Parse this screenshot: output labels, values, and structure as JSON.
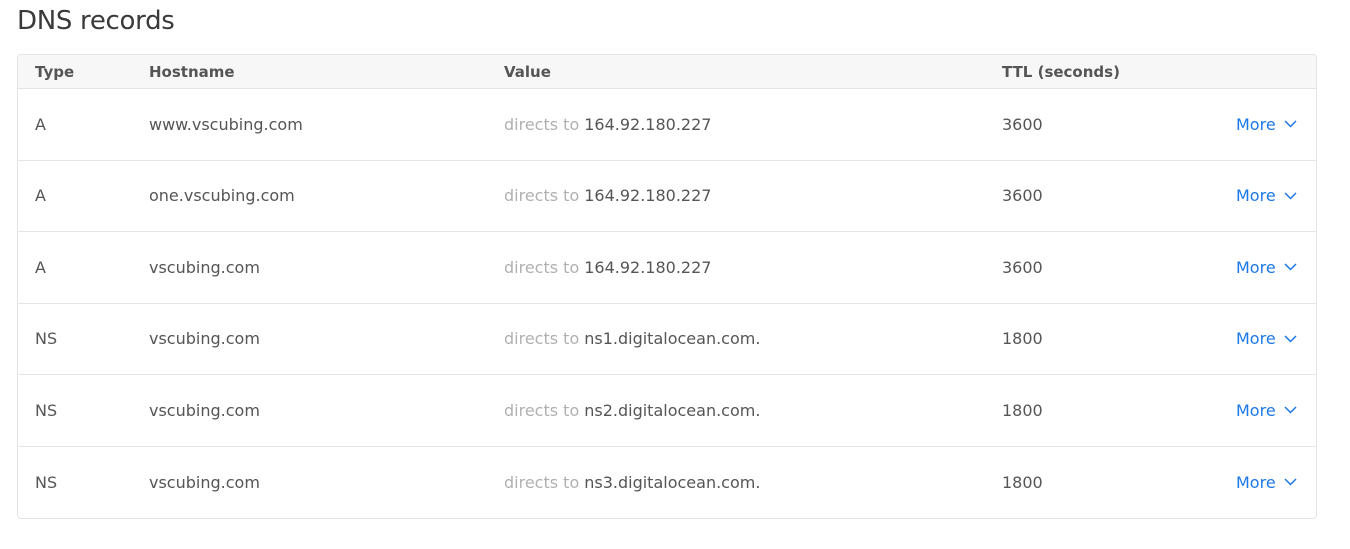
{
  "page": {
    "title": "DNS records"
  },
  "columns": {
    "type": "Type",
    "hostname": "Hostname",
    "value": "Value",
    "ttl": "TTL (seconds)"
  },
  "records": [
    {
      "type": "A",
      "hostname": "www.vscubing.com",
      "prefix": "directs to",
      "value": "164.92.180.227",
      "ttl": "3600",
      "action": "More"
    },
    {
      "type": "A",
      "hostname": "one.vscubing.com",
      "prefix": "directs to",
      "value": "164.92.180.227",
      "ttl": "3600",
      "action": "More"
    },
    {
      "type": "A",
      "hostname": "vscubing.com",
      "prefix": "directs to",
      "value": "164.92.180.227",
      "ttl": "3600",
      "action": "More"
    },
    {
      "type": "NS",
      "hostname": "vscubing.com",
      "prefix": "directs to",
      "value": "ns1.digitalocean.com.",
      "ttl": "1800",
      "action": "More"
    },
    {
      "type": "NS",
      "hostname": "vscubing.com",
      "prefix": "directs to",
      "value": "ns2.digitalocean.com.",
      "ttl": "1800",
      "action": "More"
    },
    {
      "type": "NS",
      "hostname": "vscubing.com",
      "prefix": "directs to",
      "value": "ns3.digitalocean.com.",
      "ttl": "1800",
      "action": "More"
    }
  ],
  "icons": {
    "more_chevron": "chevron-down-icon"
  },
  "colors": {
    "accent": "#1b78e6",
    "muted": "#b0b0b0",
    "text": "#555555",
    "header_bg": "#f7f7f7"
  }
}
